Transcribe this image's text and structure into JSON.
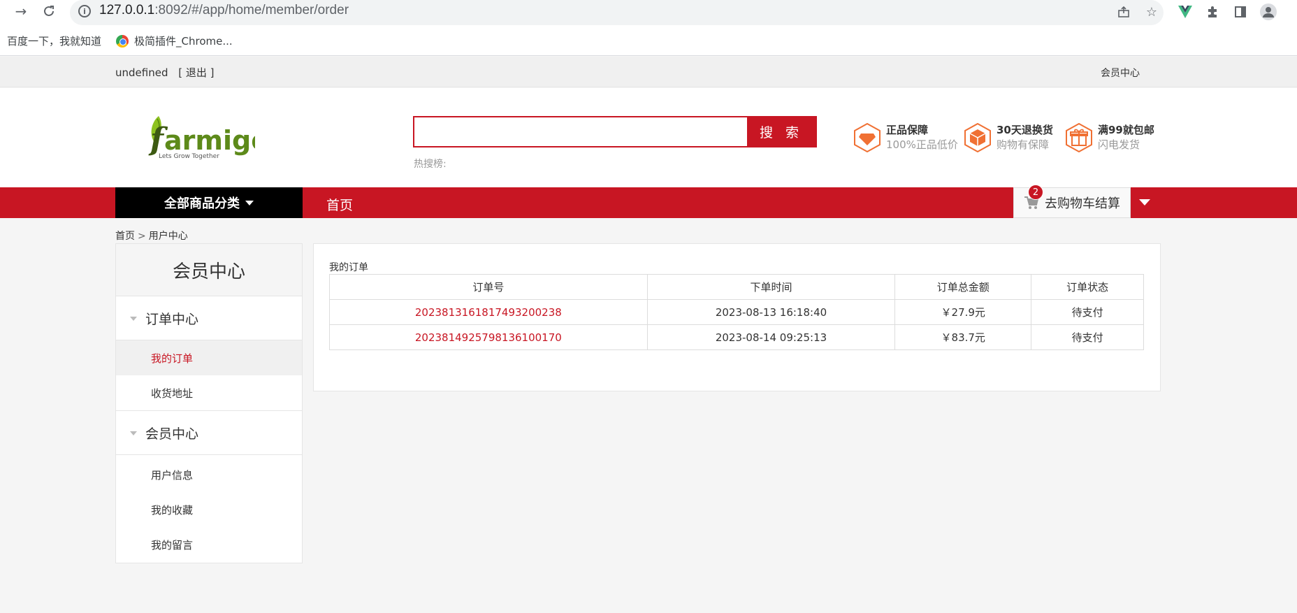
{
  "browser": {
    "url_host": "127.0.0.1",
    "url_rest": ":8092/#/app/home/member/order",
    "bookmarks": [
      "百度一下，我就知道",
      "极简插件_Chrome..."
    ]
  },
  "topbar": {
    "username": "undefined",
    "logout": "[ 退出 ]",
    "member_center": "会员中心"
  },
  "header": {
    "logo_text": "farmigo",
    "logo_tagline": "Lets Grow Together",
    "search_placeholder": "",
    "search_button": "搜 索",
    "hot_label": "热搜榜:",
    "promos": [
      {
        "title": "正品保障",
        "sub": "100%正品低价",
        "icon": "diamond-icon"
      },
      {
        "title": "30天退换货",
        "sub": "购物有保障",
        "icon": "box-icon"
      },
      {
        "title": "满99就包邮",
        "sub": "闪电发货",
        "icon": "gift-icon"
      }
    ],
    "accent_color": "#c81623"
  },
  "nav": {
    "all_categories": "全部商品分类",
    "home": "首页",
    "cart_label": "去购物车结算",
    "cart_count": "2"
  },
  "breadcrumb": {
    "home": "首页",
    "separator": ">",
    "current": "用户中心"
  },
  "sidebar": {
    "title": "会员中心",
    "groups": [
      {
        "label": "订单中心",
        "items": [
          "我的订单",
          "收货地址"
        ]
      },
      {
        "label": "会员中心",
        "items": [
          "用户信息",
          "我的收藏",
          "我的留言"
        ]
      }
    ],
    "active_item": "我的订单"
  },
  "orders": {
    "title": "我的订单",
    "columns": [
      "订单号",
      "下单时间",
      "订单总金额",
      "订单状态"
    ],
    "rows": [
      {
        "order_no": "2023813161817493200238",
        "time": "2023-08-13 16:18:40",
        "amount": "￥27.9元",
        "status": "待支付"
      },
      {
        "order_no": "2023814925798136100170",
        "time": "2023-08-14 09:25:13",
        "amount": "￥83.7元",
        "status": "待支付"
      }
    ]
  }
}
